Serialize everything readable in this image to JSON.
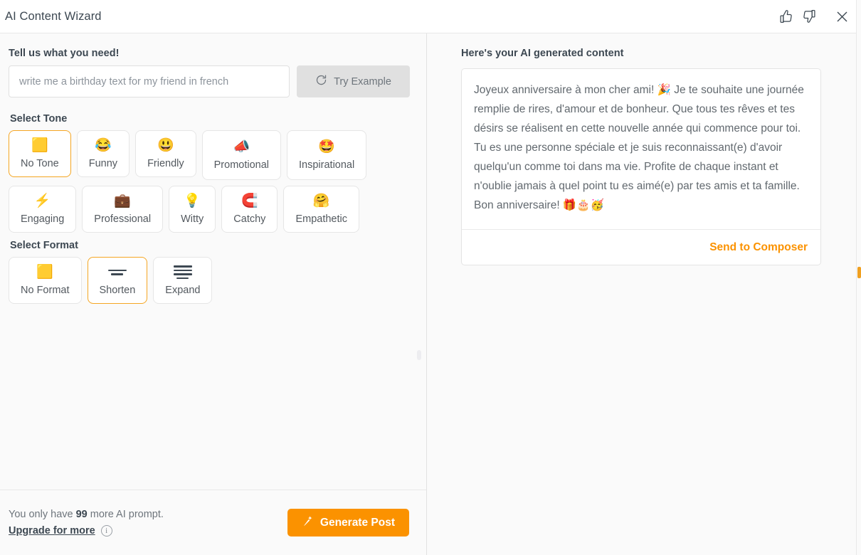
{
  "header": {
    "title": "AI Content Wizard",
    "thumbs_up_icon": "thumbs-up-icon",
    "thumbs_down_icon": "thumbs-down-icon",
    "close_icon": "close-icon"
  },
  "prompt": {
    "label": "Tell us what you need!",
    "value": "",
    "placeholder": "write me a birthday text for my friend in french",
    "try_example_label": "Try Example",
    "try_example_icon": "refresh-icon"
  },
  "tone": {
    "label": "Select Tone",
    "selected": "No Tone",
    "options": [
      {
        "label": "No Tone",
        "emoji": "🟨",
        "icon": "no-tone-face-icon",
        "selected": true,
        "tall": false
      },
      {
        "label": "Funny",
        "emoji": "😂",
        "icon": "laughing-face-icon",
        "selected": false,
        "tall": false
      },
      {
        "label": "Friendly",
        "emoji": "😃",
        "icon": "smiling-face-icon",
        "selected": false,
        "tall": false
      },
      {
        "label": "Promotional",
        "emoji": "📣",
        "icon": "megaphone-icon",
        "selected": false,
        "tall": true
      },
      {
        "label": "Inspirational",
        "emoji": "🤩",
        "icon": "star-struck-icon",
        "selected": false,
        "tall": true
      },
      {
        "label": "Engaging",
        "emoji": "⚡",
        "icon": "lightning-bolt-icon",
        "selected": false,
        "tall": false
      },
      {
        "label": "Professional",
        "emoji": "💼",
        "icon": "briefcase-icon",
        "selected": false,
        "tall": false
      },
      {
        "label": "Witty",
        "emoji": "💡",
        "icon": "lightbulb-icon",
        "selected": false,
        "tall": false
      },
      {
        "label": "Catchy",
        "emoji": "🧲",
        "icon": "magnet-icon",
        "selected": false,
        "tall": false
      },
      {
        "label": "Empathetic",
        "emoji": "🤗",
        "icon": "hugging-face-icon",
        "selected": false,
        "tall": false
      }
    ]
  },
  "format": {
    "label": "Select Format",
    "selected": "Shorten",
    "options": [
      {
        "label": "No Format",
        "emoji": "🟨",
        "icon": "no-format-face-icon",
        "selected": false,
        "lines": 0
      },
      {
        "label": "Shorten",
        "emoji": "",
        "icon": "shorten-lines-icon",
        "selected": true,
        "lines": 2
      },
      {
        "label": "Expand",
        "emoji": "",
        "icon": "expand-lines-icon",
        "selected": false,
        "lines": 4
      }
    ]
  },
  "footer": {
    "quota_prefix": "You only have ",
    "quota_count": "99",
    "quota_suffix": " more AI prompt.",
    "upgrade_label": "Upgrade for more",
    "info_icon": "info-icon",
    "generate_label": "Generate Post",
    "generate_icon": "magic-wand-icon"
  },
  "result": {
    "heading": "Here's your AI generated content",
    "text": "Joyeux anniversaire à mon cher ami! 🎉 Je te souhaite une journée remplie de rires, d'amour et de bonheur. Que tous tes rêves et tes désirs se réalisent en cette nouvelle année qui commence pour toi. Tu es une personne spéciale et je suis reconnaissant(e) d'avoir quelqu'un comme toi dans ma vie. Profite de chaque instant et n'oublie jamais à quel point tu es aimé(e) par tes amis et ta famille. Bon anniversaire! 🎁🎂🥳",
    "send_label": "Send to Composer"
  },
  "colors": {
    "accent_orange": "#fb9200",
    "selected_border": "#f5a623",
    "panel_bg": "#fafafa",
    "text_dark": "#3d4852",
    "text_muted": "#6e757c"
  }
}
